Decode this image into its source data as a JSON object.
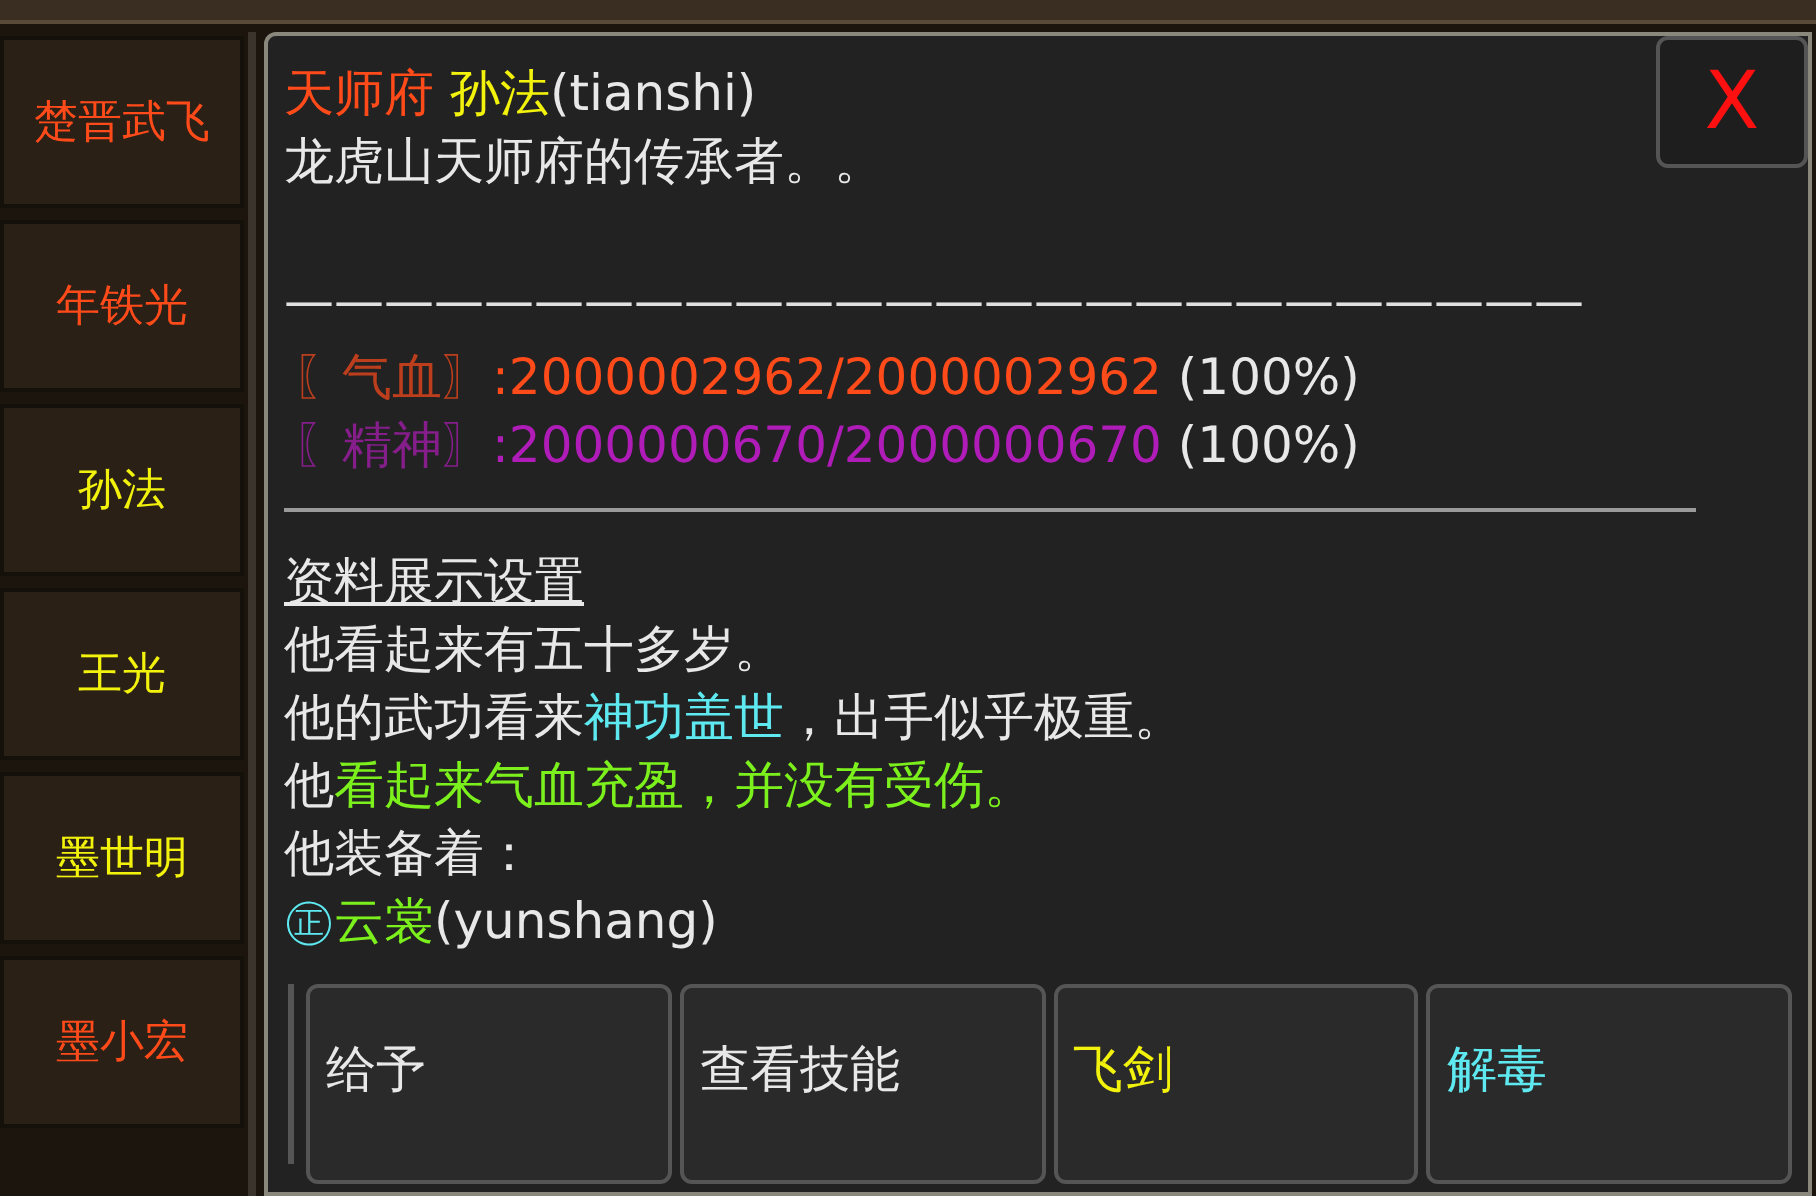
{
  "sidebar": {
    "items": [
      {
        "label": "楚晋武飞",
        "color": "#ff4a1a"
      },
      {
        "label": "年铁光",
        "color": "#ff4a1a"
      },
      {
        "label": "孙法",
        "color": "#f2f20c"
      },
      {
        "label": "王光",
        "color": "#f2f20c"
      },
      {
        "label": "墨世明",
        "color": "#f2f20c"
      },
      {
        "label": "墨小宏",
        "color": "#ff4a1a"
      }
    ]
  },
  "panel": {
    "close_button": "X",
    "title": [
      {
        "text": "天师府",
        "color": "#ff4a1a"
      },
      {
        "text": " 孙法",
        "color": "#f2f20c"
      },
      {
        "text": "(tianshi)",
        "color": "#e8e8e8"
      }
    ],
    "description": "龙虎山天师府的传承者。。",
    "separator": "——————————————————————————",
    "stats": [
      {
        "label": "〖气血〗",
        "value": ":2000002962/2000002962",
        "percent": "(100%)",
        "color": "#ff4a1a"
      },
      {
        "label": "〖精神〗",
        "value": ":2000000670/2000000670",
        "percent": "(100%)",
        "color": "#b01cb8"
      }
    ],
    "section_link": "资料展示设置",
    "lines": [
      [
        {
          "text": "他看起来有五十多岁。",
          "color": "#e8e8e8"
        }
      ],
      [
        {
          "text": "他的武功看来",
          "color": "#e8e8e8"
        },
        {
          "text": "神功盖世",
          "color": "#5ee8f0"
        },
        {
          "text": "，出手似乎极重。",
          "color": "#e8e8e8"
        }
      ],
      [
        {
          "text": "他",
          "color": "#e8e8e8"
        },
        {
          "text": "看起来气血充盈，并没有受伤。",
          "color": "#7cf01c"
        }
      ],
      [
        {
          "text": "他装备着：",
          "color": "#e8e8e8"
        }
      ],
      [
        {
          "text": "㊣",
          "color": "#5ee8f0"
        },
        {
          "text": "云裳",
          "color": "#7cf01c"
        },
        {
          "text": "(yunshang)",
          "color": "#e8e8e8"
        }
      ]
    ],
    "buttons": [
      {
        "label": "给予",
        "color": "#e8e8e8"
      },
      {
        "label": "查看技能",
        "color": "#e8e8e8"
      },
      {
        "label": "飞剑",
        "color": "#f2f20c"
      },
      {
        "label": "解毒",
        "color": "#5ee8f0"
      }
    ]
  }
}
